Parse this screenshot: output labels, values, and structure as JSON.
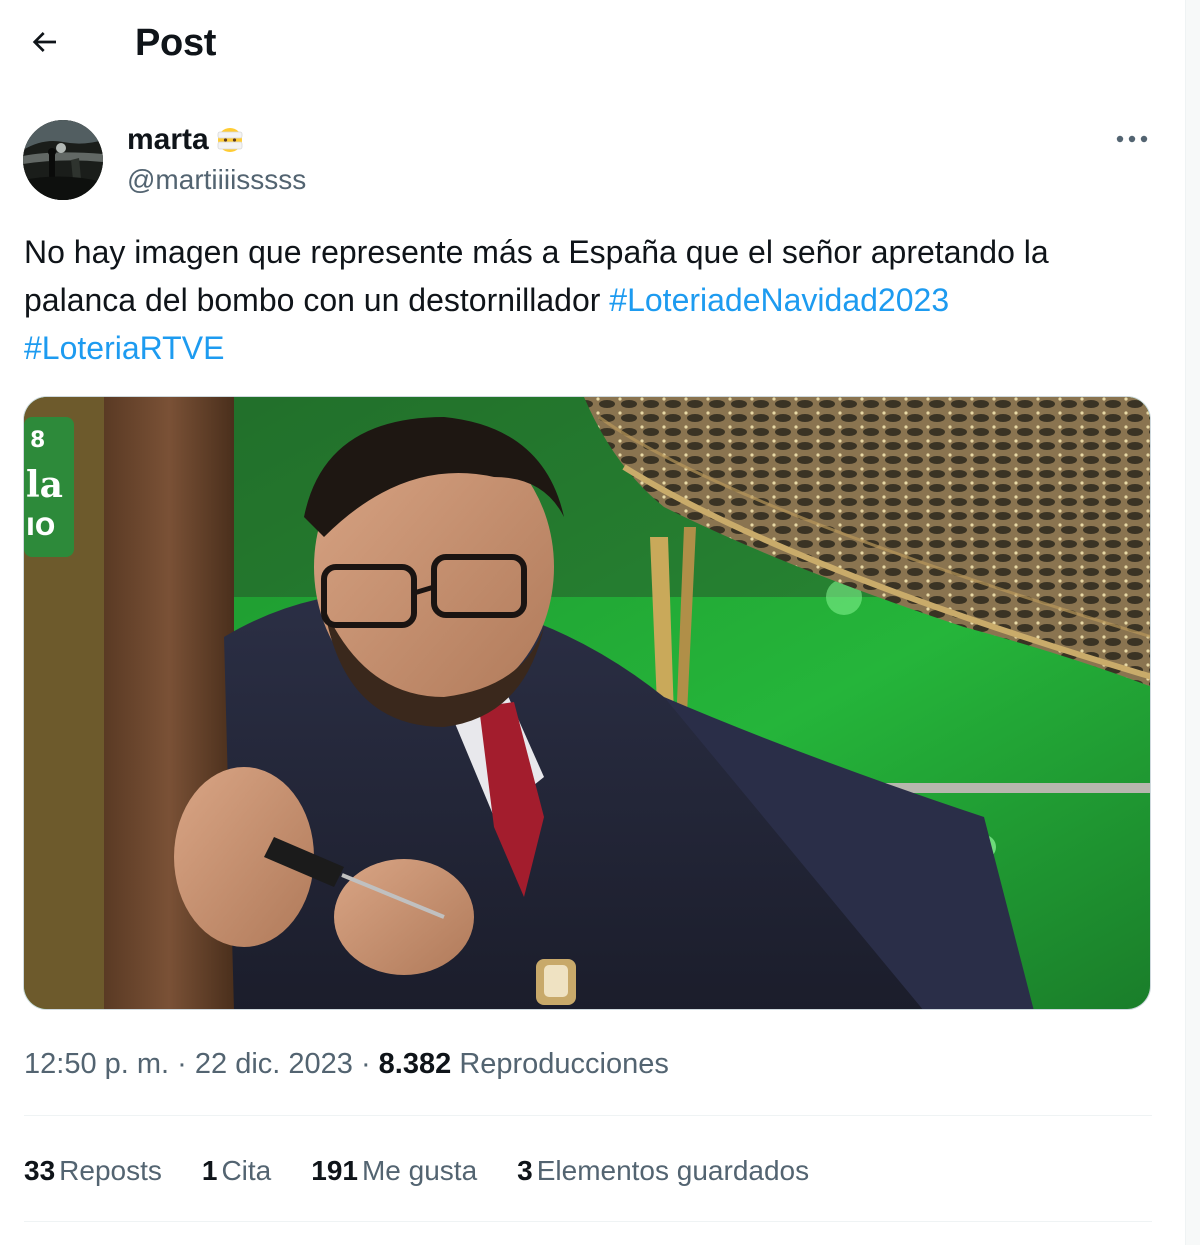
{
  "header": {
    "title": "Post",
    "back_icon": "arrow-left-icon"
  },
  "author": {
    "name": "marta",
    "badge_emoji": "face-with-bandage-emoji",
    "handle": "@martiiiissss s"
  },
  "tweet": {
    "text_plain": "No hay imagen que represente más a España que el señor apretando la palanca del bombo con un destornillador",
    "hashtags": [
      "#LoteriadeNavidad2023",
      "#LoteriaRTVE"
    ]
  },
  "media": {
    "overlay_text": [
      "8",
      "la",
      "IO"
    ]
  },
  "meta": {
    "time": "12:50 p. m.",
    "separator": " · ",
    "date": "22 dic. 2023",
    "views_count": "8.382",
    "views_label": "Reproducciones"
  },
  "stats": [
    {
      "num": "33",
      "label": "Reposts"
    },
    {
      "num": "1",
      "label": "Cita"
    },
    {
      "num": "191",
      "label": "Me gusta"
    },
    {
      "num": "3",
      "label": "Elementos guardados"
    }
  ],
  "colors": {
    "text_primary": "#0f1419",
    "text_secondary": "#536471",
    "link": "#1d9bf0",
    "border": "#eff3f4"
  },
  "icons": {
    "more": "more-horizontal-icon"
  }
}
